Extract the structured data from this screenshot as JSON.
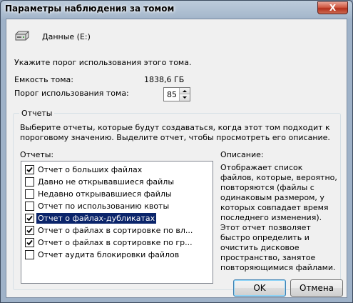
{
  "window": {
    "title": "Параметры наблюдения за томом",
    "close_label": "X"
  },
  "volume": {
    "name": "Данные (E:)"
  },
  "prompt": "Укажите порог использования этого тома.",
  "capacity": {
    "label": "Емкость тома:",
    "value": "1838,6 ГБ"
  },
  "threshold": {
    "label": "Порог использования тома:",
    "value": "85"
  },
  "reports_group": {
    "title": "Отчеты",
    "instructions": "Выберите отчеты, которые будут создаваться, когда этот том подходит к пороговому значению. Выделите отчет, чтобы просмотреть его описание.",
    "list_label": "Отчеты:",
    "items": [
      {
        "label": "Отчет о больших файлах",
        "checked": true
      },
      {
        "label": "Давно не открывавшиеся файлы",
        "checked": false
      },
      {
        "label": "Недавно открывавшиеся файлы",
        "checked": false
      },
      {
        "label": "Отчет по использованию квоты",
        "checked": false
      },
      {
        "label": "Отчет о файлах-дубликатах",
        "checked": true,
        "selected": true
      },
      {
        "label": "Отчет о файлах в сортировке по вл...",
        "checked": true
      },
      {
        "label": "Отчет о файлах в сортировке по гр...",
        "checked": true
      },
      {
        "label": "Отчет аудита блокировки файлов",
        "checked": false
      }
    ],
    "description_label": "Описание:",
    "description": "Отображает список файлов, которые, вероятно, повторяются (файлы с одинаковым размером, у которых совпадает время последнего изменения). Этот отчет позволяет быстро определить и очистить дисковое пространство, занятое повторяющимися файлами."
  },
  "buttons": {
    "ok": "OK",
    "cancel": "Отмена"
  }
}
